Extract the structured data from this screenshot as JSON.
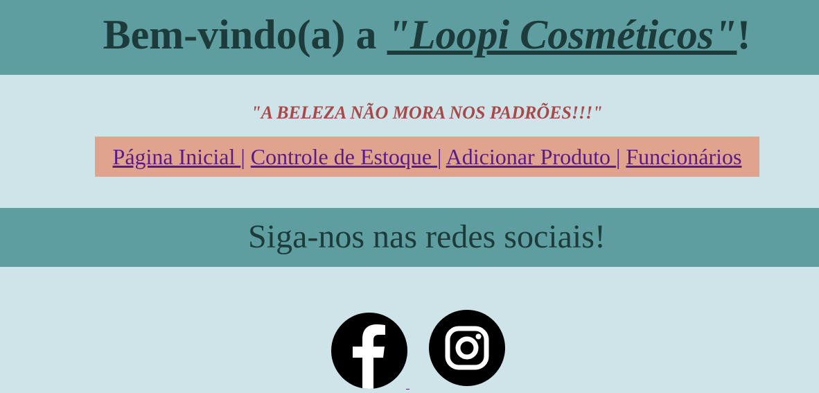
{
  "header": {
    "title_prefix": "Bem-vindo(a) a ",
    "brand_link": "\"Loopi Cosméticos\"",
    "title_suffix": "!"
  },
  "slogan": "\"A BELEZA NÃO MORA NOS PADRÕES!!!\"",
  "nav": {
    "items": [
      {
        "label": "Página Inicial "
      },
      {
        "label": "Controle de Estoque "
      },
      {
        "label": "Adicionar Produto "
      },
      {
        "label": "Funcionários"
      }
    ],
    "separator": "|"
  },
  "social": {
    "title": "Siga-nos nas redes sociais!",
    "icons": [
      "facebook-icon",
      "instagram-icon"
    ]
  },
  "colors": {
    "header_bg": "#5f9ea0",
    "page_bg": "#cee4e8",
    "nav_bg": "#e0a48e",
    "slogan": "#a84848",
    "link": "#5a1a8a",
    "heading": "#1d3b3b"
  }
}
